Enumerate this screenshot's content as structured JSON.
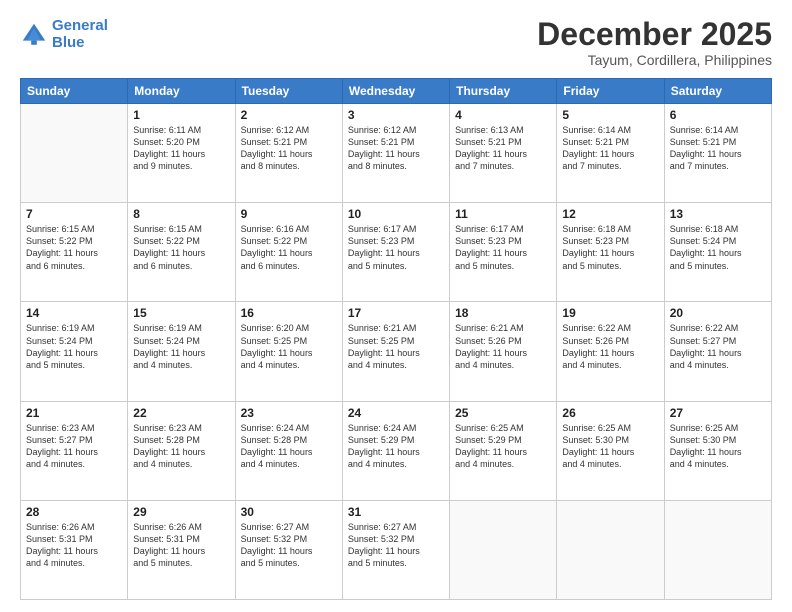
{
  "header": {
    "logo_line1": "General",
    "logo_line2": "Blue",
    "month": "December 2025",
    "location": "Tayum, Cordillera, Philippines"
  },
  "weekdays": [
    "Sunday",
    "Monday",
    "Tuesday",
    "Wednesday",
    "Thursday",
    "Friday",
    "Saturday"
  ],
  "weeks": [
    [
      {
        "day": "",
        "info": ""
      },
      {
        "day": "1",
        "info": "Sunrise: 6:11 AM\nSunset: 5:20 PM\nDaylight: 11 hours\nand 9 minutes."
      },
      {
        "day": "2",
        "info": "Sunrise: 6:12 AM\nSunset: 5:21 PM\nDaylight: 11 hours\nand 8 minutes."
      },
      {
        "day": "3",
        "info": "Sunrise: 6:12 AM\nSunset: 5:21 PM\nDaylight: 11 hours\nand 8 minutes."
      },
      {
        "day": "4",
        "info": "Sunrise: 6:13 AM\nSunset: 5:21 PM\nDaylight: 11 hours\nand 7 minutes."
      },
      {
        "day": "5",
        "info": "Sunrise: 6:14 AM\nSunset: 5:21 PM\nDaylight: 11 hours\nand 7 minutes."
      },
      {
        "day": "6",
        "info": "Sunrise: 6:14 AM\nSunset: 5:21 PM\nDaylight: 11 hours\nand 7 minutes."
      }
    ],
    [
      {
        "day": "7",
        "info": "Sunrise: 6:15 AM\nSunset: 5:22 PM\nDaylight: 11 hours\nand 6 minutes."
      },
      {
        "day": "8",
        "info": "Sunrise: 6:15 AM\nSunset: 5:22 PM\nDaylight: 11 hours\nand 6 minutes."
      },
      {
        "day": "9",
        "info": "Sunrise: 6:16 AM\nSunset: 5:22 PM\nDaylight: 11 hours\nand 6 minutes."
      },
      {
        "day": "10",
        "info": "Sunrise: 6:17 AM\nSunset: 5:23 PM\nDaylight: 11 hours\nand 5 minutes."
      },
      {
        "day": "11",
        "info": "Sunrise: 6:17 AM\nSunset: 5:23 PM\nDaylight: 11 hours\nand 5 minutes."
      },
      {
        "day": "12",
        "info": "Sunrise: 6:18 AM\nSunset: 5:23 PM\nDaylight: 11 hours\nand 5 minutes."
      },
      {
        "day": "13",
        "info": "Sunrise: 6:18 AM\nSunset: 5:24 PM\nDaylight: 11 hours\nand 5 minutes."
      }
    ],
    [
      {
        "day": "14",
        "info": "Sunrise: 6:19 AM\nSunset: 5:24 PM\nDaylight: 11 hours\nand 5 minutes."
      },
      {
        "day": "15",
        "info": "Sunrise: 6:19 AM\nSunset: 5:24 PM\nDaylight: 11 hours\nand 4 minutes."
      },
      {
        "day": "16",
        "info": "Sunrise: 6:20 AM\nSunset: 5:25 PM\nDaylight: 11 hours\nand 4 minutes."
      },
      {
        "day": "17",
        "info": "Sunrise: 6:21 AM\nSunset: 5:25 PM\nDaylight: 11 hours\nand 4 minutes."
      },
      {
        "day": "18",
        "info": "Sunrise: 6:21 AM\nSunset: 5:26 PM\nDaylight: 11 hours\nand 4 minutes."
      },
      {
        "day": "19",
        "info": "Sunrise: 6:22 AM\nSunset: 5:26 PM\nDaylight: 11 hours\nand 4 minutes."
      },
      {
        "day": "20",
        "info": "Sunrise: 6:22 AM\nSunset: 5:27 PM\nDaylight: 11 hours\nand 4 minutes."
      }
    ],
    [
      {
        "day": "21",
        "info": "Sunrise: 6:23 AM\nSunset: 5:27 PM\nDaylight: 11 hours\nand 4 minutes."
      },
      {
        "day": "22",
        "info": "Sunrise: 6:23 AM\nSunset: 5:28 PM\nDaylight: 11 hours\nand 4 minutes."
      },
      {
        "day": "23",
        "info": "Sunrise: 6:24 AM\nSunset: 5:28 PM\nDaylight: 11 hours\nand 4 minutes."
      },
      {
        "day": "24",
        "info": "Sunrise: 6:24 AM\nSunset: 5:29 PM\nDaylight: 11 hours\nand 4 minutes."
      },
      {
        "day": "25",
        "info": "Sunrise: 6:25 AM\nSunset: 5:29 PM\nDaylight: 11 hours\nand 4 minutes."
      },
      {
        "day": "26",
        "info": "Sunrise: 6:25 AM\nSunset: 5:30 PM\nDaylight: 11 hours\nand 4 minutes."
      },
      {
        "day": "27",
        "info": "Sunrise: 6:25 AM\nSunset: 5:30 PM\nDaylight: 11 hours\nand 4 minutes."
      }
    ],
    [
      {
        "day": "28",
        "info": "Sunrise: 6:26 AM\nSunset: 5:31 PM\nDaylight: 11 hours\nand 4 minutes."
      },
      {
        "day": "29",
        "info": "Sunrise: 6:26 AM\nSunset: 5:31 PM\nDaylight: 11 hours\nand 5 minutes."
      },
      {
        "day": "30",
        "info": "Sunrise: 6:27 AM\nSunset: 5:32 PM\nDaylight: 11 hours\nand 5 minutes."
      },
      {
        "day": "31",
        "info": "Sunrise: 6:27 AM\nSunset: 5:32 PM\nDaylight: 11 hours\nand 5 minutes."
      },
      {
        "day": "",
        "info": ""
      },
      {
        "day": "",
        "info": ""
      },
      {
        "day": "",
        "info": ""
      }
    ]
  ]
}
